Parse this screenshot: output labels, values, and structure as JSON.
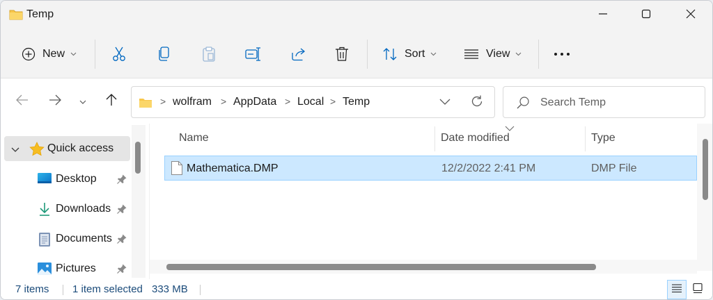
{
  "window": {
    "title": "Temp",
    "icons": {
      "title": "folder-icon",
      "minimize": "minimize-icon",
      "maximize": "maximize-icon",
      "close": "close-icon"
    }
  },
  "command_bar": {
    "new_label": "New",
    "sort_label": "Sort",
    "view_label": "View",
    "icons": [
      "plus-circle-icon",
      "cut-icon",
      "copy-icon",
      "paste-icon",
      "rename-icon",
      "share-icon",
      "delete-icon",
      "sort-icon",
      "view-icon",
      "more-icon"
    ]
  },
  "address_bar": {
    "breadcrumbs": [
      "wolfram",
      "AppData",
      "Local",
      "Temp"
    ],
    "search_placeholder": "Search Temp"
  },
  "nav_pane": {
    "quick_access": "Quick access",
    "items": [
      {
        "label": "Desktop",
        "icon": "desktop-icon",
        "pinned": true
      },
      {
        "label": "Downloads",
        "icon": "downloads-icon",
        "pinned": true
      },
      {
        "label": "Documents",
        "icon": "documents-icon",
        "pinned": true
      },
      {
        "label": "Pictures",
        "icon": "pictures-icon",
        "pinned": true
      }
    ]
  },
  "file_list": {
    "columns": [
      "Name",
      "Date modified",
      "Type"
    ],
    "rows": [
      {
        "name": "Mathematica.DMP",
        "date_modified": "12/2/2022 2:41 PM",
        "type": "DMP File",
        "selected": true
      }
    ]
  },
  "status_bar": {
    "item_count": "7 items",
    "selection": "1 item selected",
    "size": "333 MB"
  },
  "colors": {
    "selection_bg": "#cce8ff",
    "selection_border": "#99d1ff",
    "folder": "#f8c64a",
    "accent": "#0067c0",
    "status_text": "#1b4b7a"
  }
}
